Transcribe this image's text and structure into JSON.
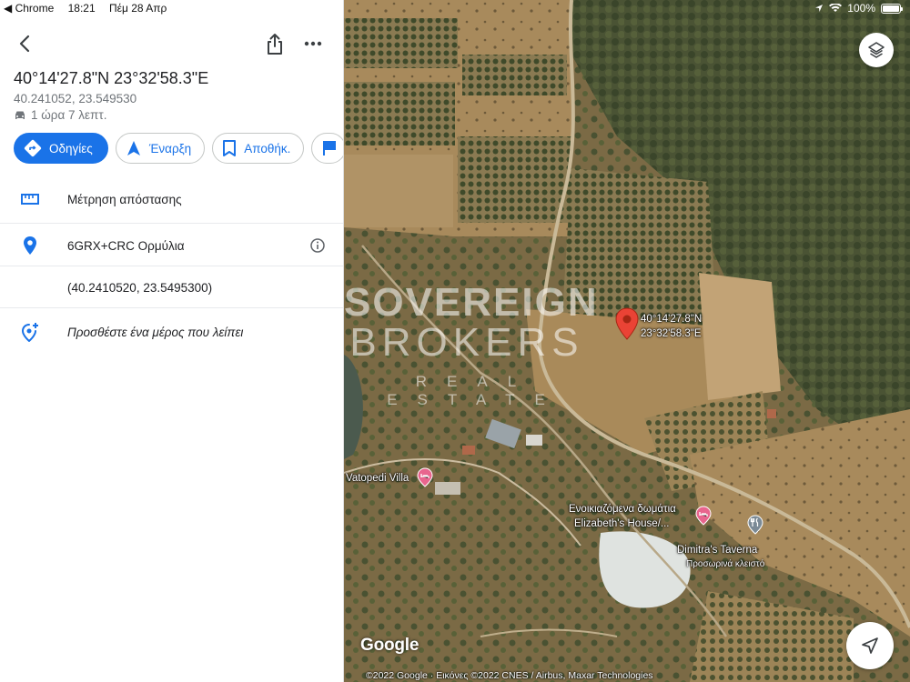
{
  "status_bar": {
    "back_app": "◀ Chrome",
    "time": "18:21",
    "date": "Πέμ 28 Απρ",
    "battery": "100%",
    "battery_level": 1.0
  },
  "place": {
    "title": "40°14'27.8\"N 23°32'58.3\"E",
    "decimal_coords": "40.241052, 23.549530",
    "drive_time": "1 ώρα 7 λεπτ."
  },
  "actions": [
    {
      "label": "Οδηγίες",
      "icon": "directions-icon"
    },
    {
      "label": "Έναρξη",
      "icon": "navigation-arrow-icon"
    },
    {
      "label": "Αποθήκ.",
      "icon": "bookmark-icon"
    },
    {
      "label": "",
      "icon": "flag-icon"
    }
  ],
  "details": {
    "measure_distance": "Μέτρηση απόστασης",
    "plus_code": "6GRX+CRC Ορμύλια",
    "coords_paren": "(40.2410520, 23.5495300)",
    "add_missing_place": "Προσθέστε ένα μέρος που λείπει"
  },
  "map": {
    "pin_label_lat": "40°14'27.8\"N",
    "pin_label_lng": "23°32'58.3\"E",
    "watermark_line1": "SOVEREIGN",
    "watermark_line2": "BROKERS",
    "watermark_line3": "REAL ESTATE",
    "poi_vatopedi": "Vatopedi Villa",
    "poi_rooms_line1": "Ενοικιαζόμενα δωμάτια",
    "poi_rooms_line2": "Elizabeth's House/...",
    "poi_taverna": "Dimitra's Taverna",
    "poi_taverna_status": "Προσωρινά κλειστό",
    "google_logo": "Google",
    "copyright": "©2022 Google · Εικόνες ©2022 CNES / Airbus, Maxar Technologies",
    "colors": {
      "pin": "#ea4335",
      "lodging_poi": "#e8658e",
      "brand_blue": "#1a73e8"
    }
  }
}
